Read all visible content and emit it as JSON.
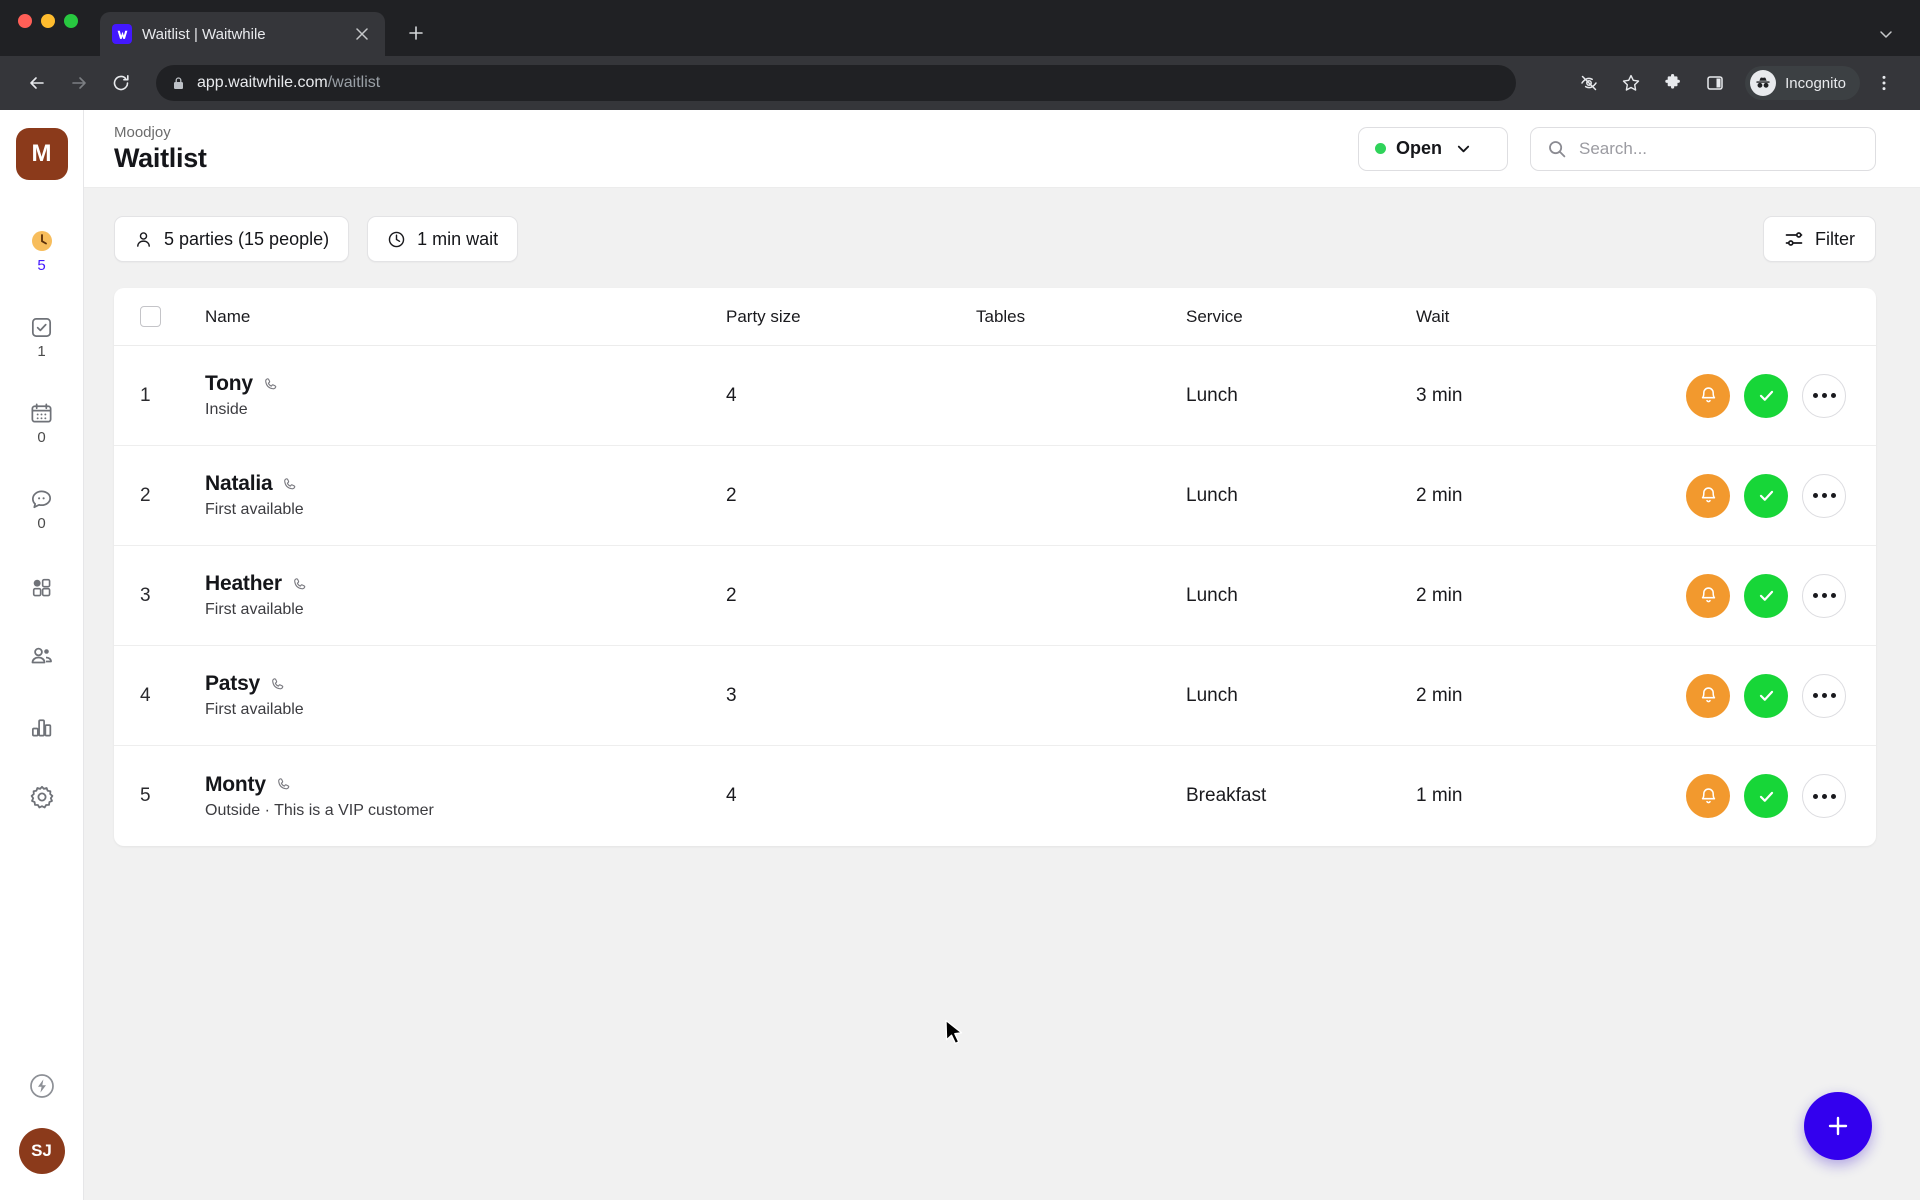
{
  "browser": {
    "tab": {
      "title": "Waitlist | Waitwhile",
      "favicon_icon": "waitwhile-logo-icon",
      "close_icon": "close-icon"
    },
    "new_tab_icon": "plus-icon",
    "tab_list_icon": "chevron-down-icon",
    "back_icon": "arrow-left-icon",
    "forward_icon": "arrow-right-icon",
    "reload_icon": "reload-icon",
    "lock_icon": "lock-icon",
    "url_host": "app.waitwhile.com",
    "url_path": "/waitlist",
    "toolbar_icons": [
      "eye-off-icon",
      "star-icon",
      "extensions-puzzle-icon",
      "side-panel-icon"
    ],
    "profile": {
      "label": "Incognito",
      "icon": "incognito-icon"
    },
    "menu_icon": "kebab-menu-icon"
  },
  "sidebar": {
    "workspace": {
      "initial": "M",
      "color": "#8b3a1b"
    },
    "items": [
      {
        "name": "waitlist",
        "icon": "clock-icon",
        "badge": "5",
        "badge_color": "#4318ff"
      },
      {
        "name": "served",
        "icon": "check-square-icon",
        "badge": "1",
        "badge_color": "#4a4a4a"
      },
      {
        "name": "bookings",
        "icon": "calendar-icon",
        "badge": "0",
        "badge_color": "#4a4a4a"
      },
      {
        "name": "messages",
        "icon": "chat-bubble-icon",
        "badge": "0",
        "badge_color": "#4a4a4a"
      },
      {
        "name": "apps",
        "icon": "grid-apps-icon",
        "badge": ""
      },
      {
        "name": "customers",
        "icon": "people-icon",
        "badge": ""
      },
      {
        "name": "analytics",
        "icon": "bar-chart-icon",
        "badge": ""
      },
      {
        "name": "settings",
        "icon": "gear-icon",
        "badge": ""
      }
    ],
    "bottom": {
      "shortcut_icon": "lightning-circle-icon",
      "avatar_initials": "SJ",
      "avatar_color": "#8b3a1b"
    }
  },
  "header": {
    "breadcrumb": "Moodjoy",
    "title": "Waitlist",
    "status": {
      "label": "Open",
      "dot_color": "#2fd35a",
      "chevron_icon": "chevron-down-icon"
    },
    "search": {
      "placeholder": "Search...",
      "value": "",
      "icon": "search-icon"
    }
  },
  "toolbar": {
    "parties_chip": {
      "label": "5 parties (15 people)",
      "icon": "person-icon"
    },
    "wait_chip": {
      "label": "1 min wait",
      "icon": "clock-icon"
    },
    "filter": {
      "label": "Filter",
      "icon": "sliders-icon"
    }
  },
  "table": {
    "select_all_icon": "checkbox-icon",
    "columns": [
      "Name",
      "Party size",
      "Tables",
      "Service",
      "Wait"
    ],
    "rows": [
      {
        "index": "1",
        "name": "Tony",
        "phone_icon": "phone-icon",
        "note": "Inside",
        "party_size": "4",
        "tables": "",
        "service": "Lunch",
        "wait": "3 min"
      },
      {
        "index": "2",
        "name": "Natalia",
        "phone_icon": "phone-icon",
        "note": "First available",
        "party_size": "2",
        "tables": "",
        "service": "Lunch",
        "wait": "2 min"
      },
      {
        "index": "3",
        "name": "Heather",
        "phone_icon": "phone-icon",
        "note": "First available",
        "party_size": "2",
        "tables": "",
        "service": "Lunch",
        "wait": "2 min"
      },
      {
        "index": "4",
        "name": "Patsy",
        "phone_icon": "phone-icon",
        "note": "First available",
        "party_size": "3",
        "tables": "",
        "service": "Lunch",
        "wait": "2 min"
      },
      {
        "index": "5",
        "name": "Monty",
        "phone_icon": "phone-icon",
        "note": "Outside  ·  This is a VIP customer",
        "party_size": "4",
        "tables": "",
        "service": "Breakfast",
        "wait": "1 min"
      }
    ],
    "row_actions": {
      "notify": {
        "icon": "bell-icon",
        "color": "#f2992e"
      },
      "complete": {
        "icon": "check-icon",
        "color": "#17d638"
      },
      "more": {
        "icon": "ellipsis-icon"
      }
    }
  },
  "fab": {
    "icon": "plus-icon",
    "color": "#3300ee"
  }
}
